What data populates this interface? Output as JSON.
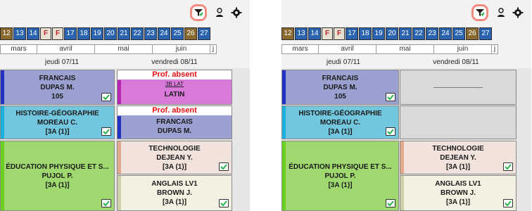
{
  "toolbar": {
    "filter_icon": "filter-icon",
    "person_icon": "person-icon",
    "gear_icon": "gear-icon"
  },
  "weeks": [
    {
      "n": "12",
      "style": "brown"
    },
    {
      "n": "13",
      "style": "blue"
    },
    {
      "n": "14",
      "style": "blue"
    },
    {
      "n": "F",
      "style": "ferie"
    },
    {
      "n": "F",
      "style": "ferie"
    },
    {
      "n": "17",
      "style": "blue"
    },
    {
      "n": "18",
      "style": "blue"
    },
    {
      "n": "19",
      "style": "blue"
    },
    {
      "n": "20",
      "style": "blue"
    },
    {
      "n": "21",
      "style": "blue"
    },
    {
      "n": "22",
      "style": "blue"
    },
    {
      "n": "23",
      "style": "blue"
    },
    {
      "n": "24",
      "style": "blue"
    },
    {
      "n": "25",
      "style": "blue"
    },
    {
      "n": "26",
      "style": "current"
    },
    {
      "n": "27",
      "style": "end"
    }
  ],
  "months": [
    "mars",
    "avril",
    "mai",
    "juin",
    "j"
  ],
  "days": {
    "left": "jeudi 07/11",
    "right": "vendredi 08/11"
  },
  "left": {
    "thu": [
      {
        "subject": "FRANCAIS",
        "teacher": "DUPAS M.",
        "room": "105"
      },
      {
        "subject": "HISTOIRE-GÉOGRAPHIE",
        "teacher": "MOREAU C.",
        "room": "[3A (1)]"
      },
      {
        "subject": "ÉDUCATION PHYSIQUE ET S...",
        "teacher": "PUJOL P.",
        "room": "[3A (1)]"
      }
    ],
    "fri": [
      {
        "status": "Prof. absent",
        "group": "3B LAT",
        "subject": "LATIN"
      },
      {
        "status": "Prof. absent",
        "subject": "FRANCAIS",
        "teacher": "DUPAS M."
      },
      {
        "subject": "TECHNOLOGIE",
        "teacher": "DEJEAN Y.",
        "room": "[3A (1)]"
      },
      {
        "subject": "ANGLAIS LV1",
        "teacher": "BROWN J.",
        "room": "[3A (1)]"
      }
    ]
  },
  "right": {
    "thu": [
      {
        "subject": "FRANCAIS",
        "teacher": "DUPAS M.",
        "room": "105"
      },
      {
        "subject": "HISTOIRE-GÉOGRAPHIE",
        "teacher": "MOREAU C.",
        "room": "[3A (1)]"
      },
      {
        "subject": "ÉDUCATION PHYSIQUE ET S...",
        "teacher": "PUJOL P.",
        "room": "[3A (1)]"
      }
    ],
    "fri": [
      {
        "subject": "TECHNOLOGIE",
        "teacher": "DEJEAN Y.",
        "room": "[3A (1)]"
      },
      {
        "subject": "ANGLAIS LV1",
        "teacher": "BROWN J.",
        "room": "[3A (1)]"
      }
    ]
  },
  "colors": {
    "francais": "#9aa0cf",
    "francais_bar": "#2233c4",
    "histoire": "#72c6de",
    "histoire_bar": "#1bb0e0",
    "eps": "#9fd86e",
    "eps_bar": "#6ad11e",
    "latin": "#d97ad9",
    "latin_bar": "#b526b5",
    "techno": "#f2e2dc",
    "techno_bar": "#e3a98c",
    "anglais": "#f3f2e2",
    "anglais_bar": "#cfcfa8",
    "empty": "#d9d9d9",
    "highlight": "#f28b7d"
  }
}
